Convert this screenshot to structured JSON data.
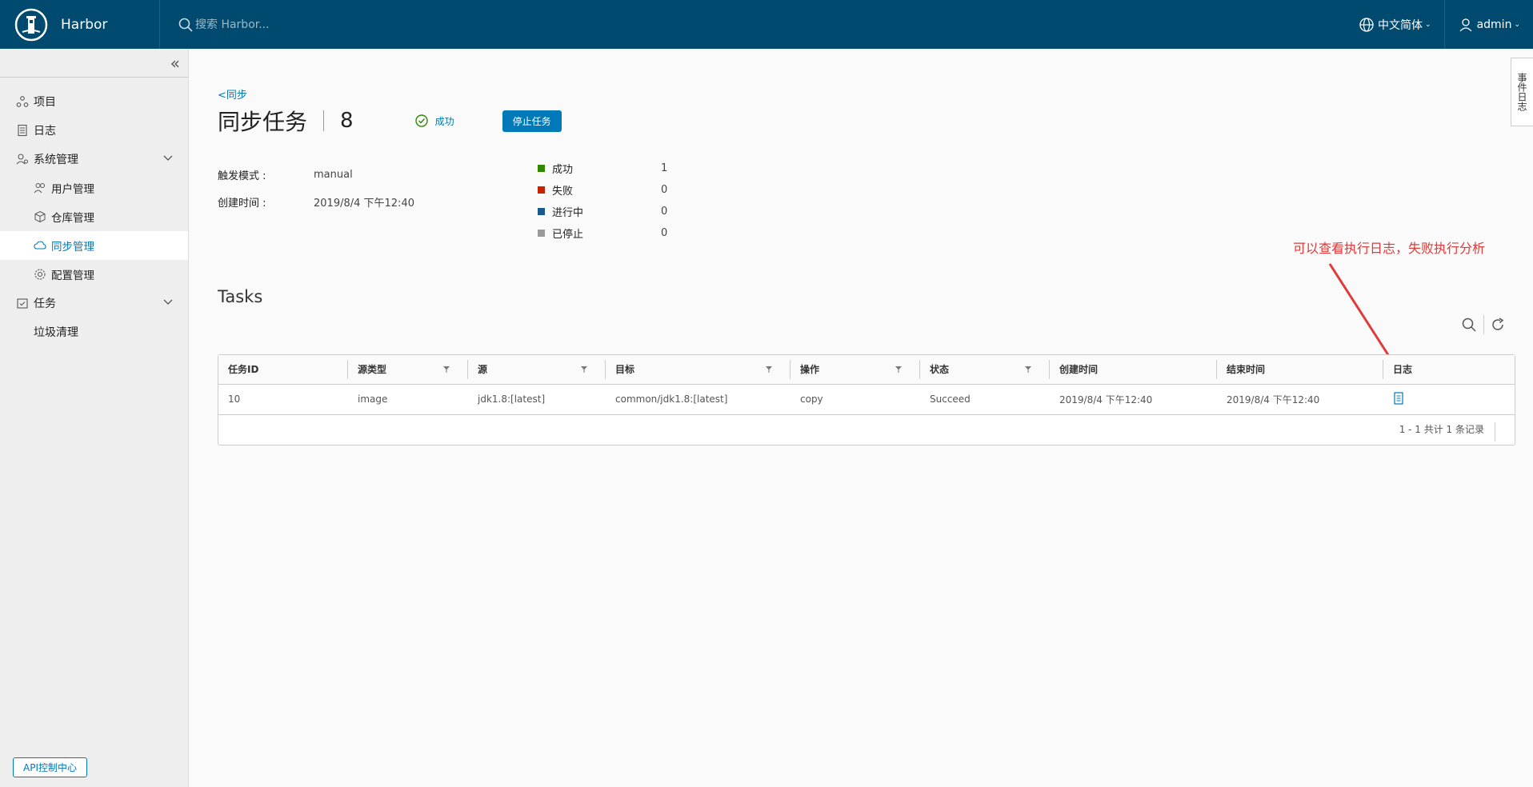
{
  "header": {
    "app_name": "Harbor",
    "search_placeholder": "搜索 Harbor...",
    "language": "中文简体",
    "user": "admin"
  },
  "sidebar": {
    "items": [
      {
        "label": "项目",
        "icon": "projects-icon"
      },
      {
        "label": "日志",
        "icon": "log-icon"
      },
      {
        "label": "系统管理",
        "icon": "admin-icon"
      },
      {
        "label": "用户管理",
        "icon": "users-icon"
      },
      {
        "label": "仓库管理",
        "icon": "registry-icon"
      },
      {
        "label": "同步管理",
        "icon": "replication-icon"
      },
      {
        "label": "配置管理",
        "icon": "config-icon"
      },
      {
        "label": "任务",
        "icon": "tasks-icon"
      },
      {
        "label": "垃圾清理"
      }
    ],
    "api_button": "API控制中心"
  },
  "right_tab": "事件日志",
  "page": {
    "back_link": "<同步",
    "title": "同步任务",
    "task_number": "8",
    "status": "成功",
    "stop_button": "停止任务",
    "info": [
      {
        "label": "触发模式 :",
        "value": "manual"
      },
      {
        "label": "创建时间 :",
        "value": "2019/8/4 下午12:40"
      }
    ],
    "stats": [
      {
        "label": "成功",
        "value": "1",
        "color": "#318700"
      },
      {
        "label": "失败",
        "value": "0",
        "color": "#c92100"
      },
      {
        "label": "进行中",
        "value": "0",
        "color": "#1d5a8c"
      },
      {
        "label": "已停止",
        "value": "0",
        "color": "#9a9a9a"
      }
    ],
    "annotation": "可以查看执行日志，失败执行分析",
    "tasks_title": "Tasks"
  },
  "table": {
    "columns": [
      "任务ID",
      "源类型",
      "源",
      "目标",
      "操作",
      "状态",
      "创建时间",
      "结束时间",
      "日志"
    ],
    "rows": [
      [
        "10",
        "image",
        "jdk1.8:[latest]",
        "common/jdk1.8:[latest]",
        "copy",
        "Succeed",
        "2019/8/4 下午12:40",
        "2019/8/4 下午12:40"
      ]
    ],
    "footer": "1 - 1 共计 1 条记录"
  }
}
